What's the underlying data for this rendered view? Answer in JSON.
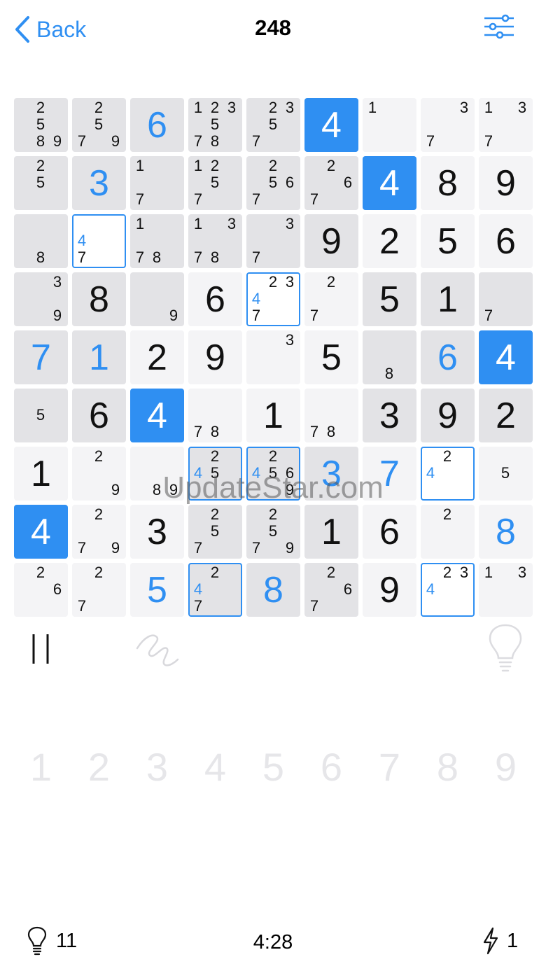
{
  "header": {
    "back_label": "Back",
    "puzzle_number": "248",
    "settings_icon": "sliders-icon"
  },
  "colors": {
    "accent": "#2f8ff2",
    "cell_background": "#f4f4f6",
    "highlight_background": "#e3e3e6",
    "numpad_disabled": "#e6e6e9"
  },
  "board": {
    "rows": [
      [
        {
          "notes": [
            2,
            5,
            8,
            9
          ],
          "hl": true
        },
        {
          "notes": [
            2,
            5,
            7,
            9
          ],
          "hl": true
        },
        {
          "value": "6",
          "kind": "entered",
          "hl": true
        },
        {
          "notes": [
            1,
            2,
            3,
            5,
            7,
            8
          ],
          "hl": true
        },
        {
          "notes": [
            2,
            3,
            5,
            7
          ],
          "hl": true
        },
        {
          "value": "4",
          "kind": "blue"
        },
        {
          "notes": [
            1
          ]
        },
        {
          "notes": [
            3,
            7
          ]
        },
        {
          "notes": [
            1,
            3,
            7
          ]
        }
      ],
      [
        {
          "notes": [
            2,
            5
          ],
          "hl": true
        },
        {
          "value": "3",
          "kind": "entered",
          "hl": true
        },
        {
          "notes": [
            1,
            7
          ],
          "hl": true
        },
        {
          "notes": [
            1,
            2,
            5,
            7
          ],
          "hl": true
        },
        {
          "notes": [
            2,
            5,
            6,
            7
          ],
          "hl": true
        },
        {
          "notes": [
            2,
            6,
            7
          ],
          "hl": true
        },
        {
          "value": "4",
          "kind": "blue"
        },
        {
          "value": "8",
          "kind": "given"
        },
        {
          "value": "9",
          "kind": "given"
        }
      ],
      [
        {
          "notes": [
            8
          ],
          "hl": true
        },
        {
          "notes": [
            4,
            7
          ],
          "blue_notes": [
            4
          ],
          "sel": true
        },
        {
          "notes": [
            1,
            7,
            8
          ],
          "hl": true
        },
        {
          "notes": [
            1,
            3,
            7,
            8
          ],
          "hl": true
        },
        {
          "notes": [
            3,
            7
          ],
          "hl": true
        },
        {
          "value": "9",
          "kind": "given",
          "hl": true
        },
        {
          "value": "2",
          "kind": "given"
        },
        {
          "value": "5",
          "kind": "given"
        },
        {
          "value": "6",
          "kind": "given"
        }
      ],
      [
        {
          "notes": [
            3,
            9
          ],
          "hl": true
        },
        {
          "value": "8",
          "kind": "given",
          "hl": true
        },
        {
          "notes": [
            9
          ],
          "hl": true
        },
        {
          "value": "6",
          "kind": "given"
        },
        {
          "notes": [
            2,
            3,
            4,
            7
          ],
          "blue_notes": [
            4
          ],
          "sel": true
        },
        {
          "notes": [
            2,
            7
          ]
        },
        {
          "value": "5",
          "kind": "given",
          "hl": true
        },
        {
          "value": "1",
          "kind": "given",
          "hl": true
        },
        {
          "notes": [
            7
          ],
          "hl": true
        }
      ],
      [
        {
          "value": "7",
          "kind": "entered",
          "hl": true
        },
        {
          "value": "1",
          "kind": "entered",
          "hl": true
        },
        {
          "value": "2",
          "kind": "given"
        },
        {
          "value": "9",
          "kind": "given"
        },
        {
          "notes": [
            3
          ]
        },
        {
          "value": "5",
          "kind": "given"
        },
        {
          "notes": [
            8
          ],
          "hl": true
        },
        {
          "value": "6",
          "kind": "entered",
          "hl": true
        },
        {
          "value": "4",
          "kind": "blue"
        }
      ],
      [
        {
          "notes": [
            5
          ],
          "hl": true
        },
        {
          "value": "6",
          "kind": "given",
          "hl": true
        },
        {
          "value": "4",
          "kind": "blue"
        },
        {
          "notes": [
            7,
            8
          ]
        },
        {
          "value": "1",
          "kind": "given"
        },
        {
          "notes": [
            7,
            8
          ]
        },
        {
          "value": "3",
          "kind": "given",
          "hl": true
        },
        {
          "value": "9",
          "kind": "given",
          "hl": true
        },
        {
          "value": "2",
          "kind": "given",
          "hl": true
        }
      ],
      [
        {
          "value": "1",
          "kind": "given"
        },
        {
          "notes": [
            2,
            9
          ]
        },
        {
          "notes": [
            8,
            9
          ]
        },
        {
          "notes": [
            2,
            4,
            5
          ],
          "blue_notes": [
            4
          ],
          "sel": true,
          "hl": true
        },
        {
          "notes": [
            2,
            4,
            5,
            6,
            9
          ],
          "blue_notes": [
            4
          ],
          "sel": true,
          "hl": true
        },
        {
          "value": "3",
          "kind": "entered",
          "hl": true
        },
        {
          "value": "7",
          "kind": "entered"
        },
        {
          "notes": [
            2,
            4
          ],
          "blue_notes": [
            4
          ],
          "sel": true
        },
        {
          "notes": [
            5
          ]
        }
      ],
      [
        {
          "value": "4",
          "kind": "blue"
        },
        {
          "notes": [
            2,
            7,
            9
          ]
        },
        {
          "value": "3",
          "kind": "given"
        },
        {
          "notes": [
            2,
            5,
            7
          ],
          "hl": true
        },
        {
          "notes": [
            2,
            5,
            7,
            9
          ],
          "hl": true
        },
        {
          "value": "1",
          "kind": "given",
          "hl": true
        },
        {
          "value": "6",
          "kind": "given"
        },
        {
          "notes": [
            2
          ]
        },
        {
          "value": "8",
          "kind": "entered"
        }
      ],
      [
        {
          "notes": [
            2,
            6
          ]
        },
        {
          "notes": [
            2,
            7
          ]
        },
        {
          "value": "5",
          "kind": "entered"
        },
        {
          "notes": [
            2,
            4,
            7
          ],
          "blue_notes": [
            4
          ],
          "sel": true,
          "hl": true
        },
        {
          "value": "8",
          "kind": "entered",
          "hl": true
        },
        {
          "notes": [
            2,
            6,
            7
          ],
          "hl": true
        },
        {
          "value": "9",
          "kind": "given"
        },
        {
          "notes": [
            2,
            3,
            4
          ],
          "blue_notes": [
            4
          ],
          "sel": true
        },
        {
          "notes": [
            1,
            3
          ]
        }
      ]
    ]
  },
  "toolbar": {
    "pause_icon": "pause-icon",
    "pencil_icon": "pencil-scribble-icon",
    "hint_icon": "lightbulb-icon"
  },
  "numpad": {
    "keys": [
      "1",
      "2",
      "3",
      "4",
      "5",
      "6",
      "7",
      "8",
      "9"
    ]
  },
  "status": {
    "hints_icon": "lightbulb-icon",
    "hints_remaining": "11",
    "timer": "4:28",
    "energy_icon": "lightning-icon",
    "energy_count": "1"
  },
  "watermark": "UpdateStar.com"
}
